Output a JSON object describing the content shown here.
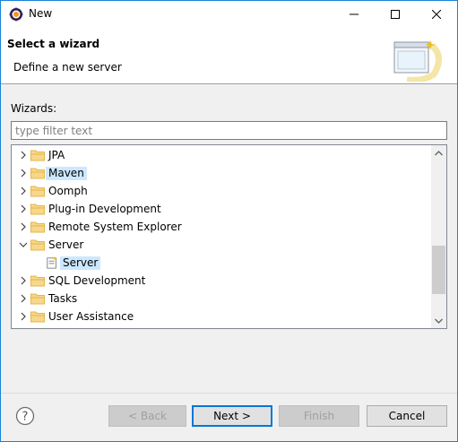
{
  "window": {
    "title": "New"
  },
  "banner": {
    "heading": "Select a wizard",
    "description": "Define a new server"
  },
  "content": {
    "wizards_label": "Wizards:",
    "filter": {
      "value": "",
      "placeholder": "type filter text"
    }
  },
  "tree": {
    "items": [
      {
        "label": "JPA",
        "expanded": false,
        "level": 0,
        "icon": "folder-icon"
      },
      {
        "label": "Maven",
        "expanded": false,
        "level": 0,
        "icon": "folder-icon",
        "highlighted": true
      },
      {
        "label": "Oomph",
        "expanded": false,
        "level": 0,
        "icon": "folder-icon"
      },
      {
        "label": "Plug-in Development",
        "expanded": false,
        "level": 0,
        "icon": "folder-icon"
      },
      {
        "label": "Remote System Explorer",
        "expanded": false,
        "level": 0,
        "icon": "folder-icon"
      },
      {
        "label": "Server",
        "expanded": true,
        "level": 0,
        "icon": "folder-icon"
      },
      {
        "label": "Server",
        "level": 1,
        "icon": "server-wizard-icon",
        "selected": true
      },
      {
        "label": "SQL Development",
        "expanded": false,
        "level": 0,
        "icon": "folder-icon"
      },
      {
        "label": "Tasks",
        "expanded": false,
        "level": 0,
        "icon": "folder-icon"
      },
      {
        "label": "User Assistance",
        "expanded": false,
        "level": 0,
        "icon": "folder-icon"
      }
    ]
  },
  "buttons": {
    "back": "< Back",
    "next": "Next >",
    "finish": "Finish",
    "cancel": "Cancel"
  },
  "colors": {
    "accent": "#0078d7",
    "selection": "#cce8ff",
    "folder": "#e8b64a"
  }
}
